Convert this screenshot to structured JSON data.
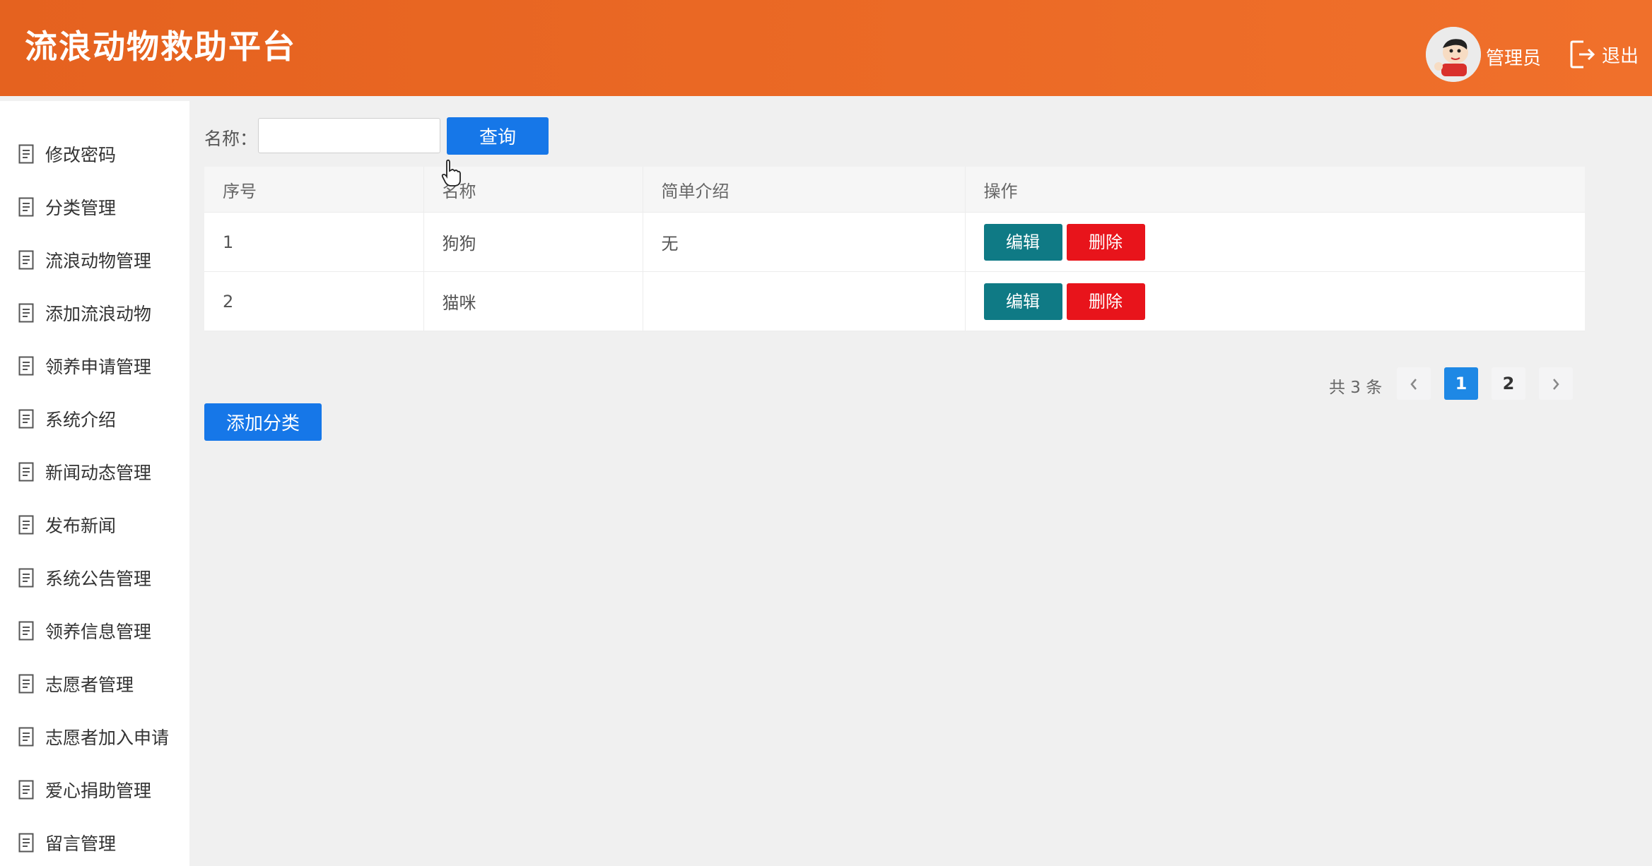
{
  "header": {
    "title": "流浪动物救助平台",
    "user_name": "管理员",
    "logout_label": "退出"
  },
  "sidebar": {
    "items": [
      {
        "label": "修改密码"
      },
      {
        "label": "分类管理"
      },
      {
        "label": "流浪动物管理"
      },
      {
        "label": "添加流浪动物"
      },
      {
        "label": "领养申请管理"
      },
      {
        "label": "系统介绍"
      },
      {
        "label": "新闻动态管理"
      },
      {
        "label": "发布新闻"
      },
      {
        "label": "系统公告管理"
      },
      {
        "label": "领养信息管理"
      },
      {
        "label": "志愿者管理"
      },
      {
        "label": "志愿者加入申请"
      },
      {
        "label": "爱心捐助管理"
      },
      {
        "label": "留言管理"
      }
    ]
  },
  "search": {
    "label": "名称：",
    "value": "",
    "button_label": "查询"
  },
  "table": {
    "columns": [
      "序号",
      "名称",
      "简单介绍",
      "操作"
    ],
    "rows": [
      {
        "index": "1",
        "name": "狗狗",
        "intro": "无",
        "edit": "编辑",
        "delete": "删除"
      },
      {
        "index": "2",
        "name": "猫咪",
        "intro": "",
        "edit": "编辑",
        "delete": "删除"
      }
    ]
  },
  "pagination": {
    "total_text": "共 3 条",
    "pages": [
      "1",
      "2"
    ],
    "current": "1"
  },
  "add_button_label": "添加分类",
  "colors": {
    "header": "#ea6826",
    "primary": "#1677e8",
    "edit": "#0f7a85",
    "delete": "#e8141b"
  },
  "icons": {
    "menu_item": "document-icon",
    "logout": "logout-icon",
    "prev": "chevron-left-icon",
    "next": "chevron-right-icon"
  }
}
